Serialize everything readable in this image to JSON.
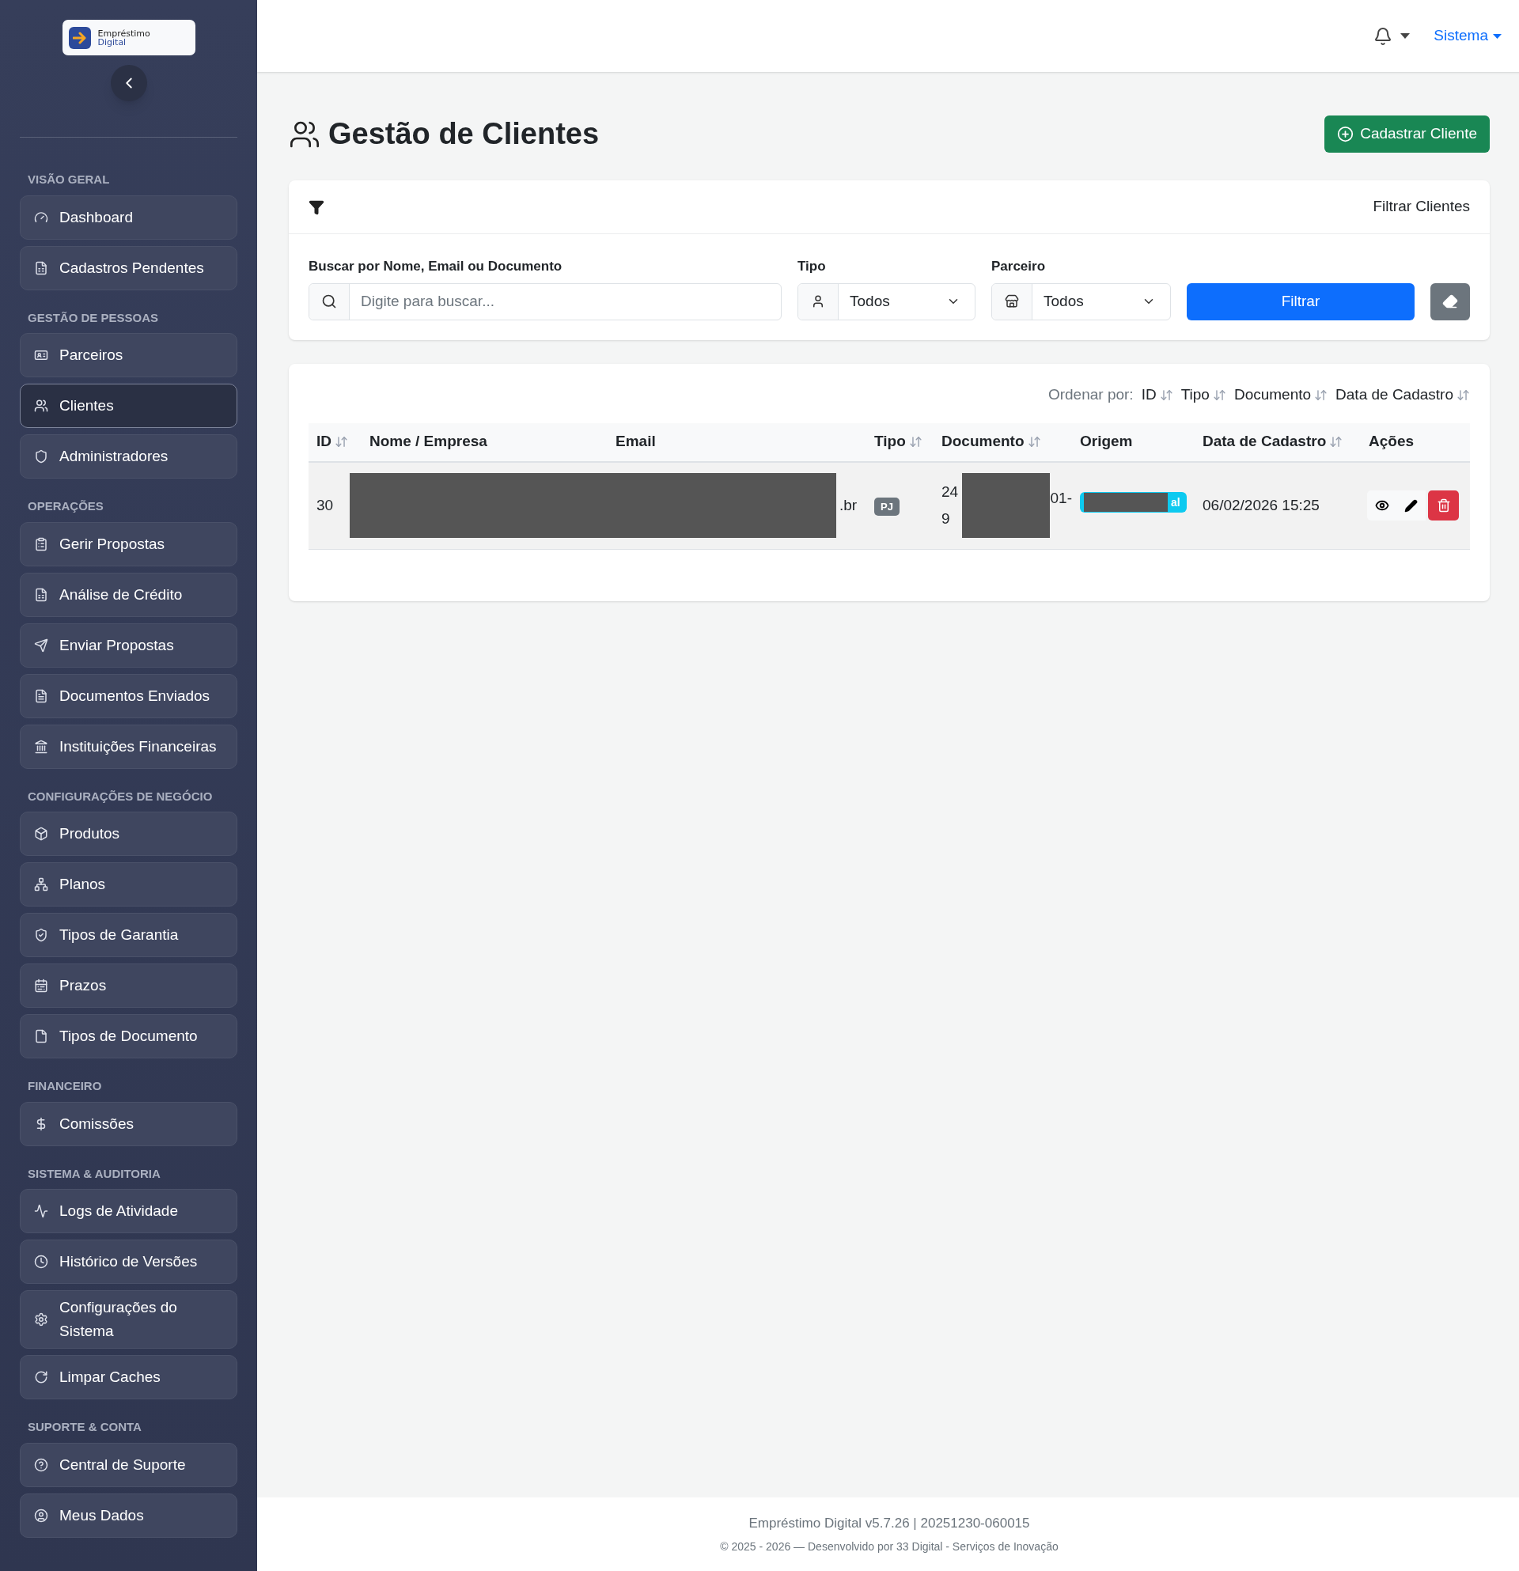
{
  "sidebar": {
    "logo": {
      "line_1": "Empréstimo",
      "line_2": "Digital"
    },
    "sections": [
      {
        "title": "VISÃO GERAL",
        "items": [
          {
            "label": "Dashboard",
            "selected": false
          },
          {
            "label": "Cadastros Pendentes",
            "selected": false
          }
        ]
      },
      {
        "title": "GESTÃO DE PESSOAS",
        "items": [
          {
            "label": "Parceiros",
            "selected": false
          },
          {
            "label": "Clientes",
            "selected": true
          },
          {
            "label": "Administradores",
            "selected": false
          }
        ]
      },
      {
        "title": "OPERAÇÕES",
        "items": [
          {
            "label": "Gerir Propostas",
            "selected": false
          },
          {
            "label": "Análise de Crédito",
            "selected": false
          },
          {
            "label": "Enviar Propostas",
            "selected": false
          },
          {
            "label": "Documentos Enviados",
            "selected": false
          },
          {
            "label": "Instituições Financeiras",
            "selected": false
          }
        ]
      },
      {
        "title": "CONFIGURAÇÕES DE NEGÓCIO",
        "items": [
          {
            "label": "Produtos",
            "selected": false
          },
          {
            "label": "Planos",
            "selected": false
          },
          {
            "label": "Tipos de Garantia",
            "selected": false
          },
          {
            "label": "Prazos",
            "selected": false
          },
          {
            "label": "Tipos de Documento",
            "selected": false
          }
        ]
      },
      {
        "title": "FINANCEIRO",
        "items": [
          {
            "label": "Comissões",
            "selected": false
          }
        ]
      },
      {
        "title": "SISTEMA & AUDITORIA",
        "items": [
          {
            "label": "Logs de Atividade",
            "selected": false
          },
          {
            "label": "Histórico de Versões",
            "selected": false
          },
          {
            "label": "Configurações do Sistema",
            "selected": false
          },
          {
            "label": "Limpar Caches",
            "selected": false
          }
        ]
      },
      {
        "title": "SUPORTE & CONTA",
        "items": [
          {
            "label": "Central de Suporte",
            "selected": false
          },
          {
            "label": "Meus Dados",
            "selected": false
          }
        ]
      }
    ]
  },
  "topbar": {
    "user_menu": "Sistema"
  },
  "page": {
    "title": "Gestão de Clientes",
    "create_button": "Cadastrar Cliente"
  },
  "filters": {
    "title": "Filtrar Clientes",
    "search": {
      "label": "Buscar por Nome, Email ou Documento",
      "placeholder": "Digite para buscar..."
    },
    "tipo": {
      "label": "Tipo",
      "value": "Todos"
    },
    "parceiro": {
      "label": "Parceiro",
      "value": "Todos"
    },
    "submit_button": "Filtrar"
  },
  "table": {
    "sort_label": "Ordenar por:",
    "sort_options": [
      "ID",
      "Tipo",
      "Documento",
      "Data de Cadastro"
    ],
    "columns": [
      {
        "label": "ID",
        "sortable": true
      },
      {
        "label": "Nome / Empresa",
        "sortable": false
      },
      {
        "label": "Email",
        "sortable": false
      },
      {
        "label": "Tipo",
        "sortable": true
      },
      {
        "label": "Documento",
        "sortable": true
      },
      {
        "label": "Origem",
        "sortable": false
      },
      {
        "label": "Data de Cadastro",
        "sortable": true
      },
      {
        "label": "Ações",
        "sortable": false
      }
    ],
    "rows": [
      {
        "id": "30",
        "email_fragment": ".br",
        "tipo": "PJ",
        "documento_fragments": [
          "24",
          "9",
          "01-"
        ],
        "origem_fragment": "al",
        "data": "06/02/2026 15:25"
      }
    ]
  },
  "footer": {
    "version": "Empréstimo Digital v5.7.26 | 20251230-060015",
    "copyright": "© 2025 - 2026 — Desenvolvido por 33 Digital - Serviços de Inovação"
  }
}
